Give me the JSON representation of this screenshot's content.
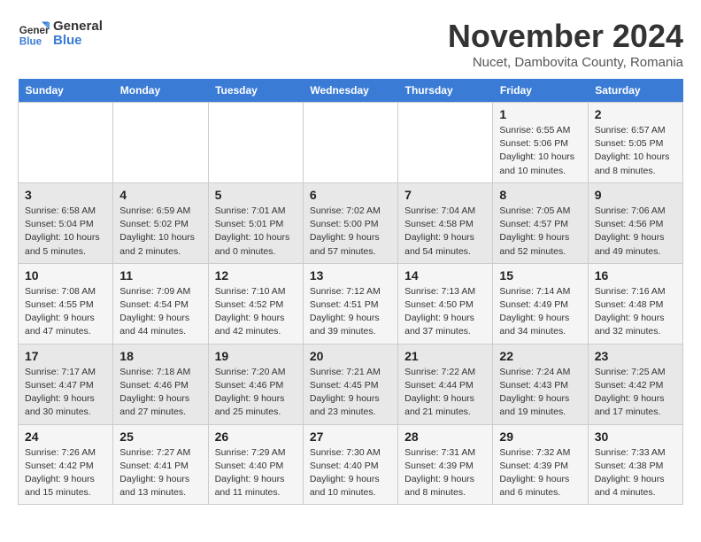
{
  "logo": {
    "line1": "General",
    "line2": "Blue"
  },
  "title": "November 2024",
  "location": "Nucet, Dambovita County, Romania",
  "days_of_week": [
    "Sunday",
    "Monday",
    "Tuesday",
    "Wednesday",
    "Thursday",
    "Friday",
    "Saturday"
  ],
  "weeks": [
    [
      {
        "day": "",
        "info": ""
      },
      {
        "day": "",
        "info": ""
      },
      {
        "day": "",
        "info": ""
      },
      {
        "day": "",
        "info": ""
      },
      {
        "day": "",
        "info": ""
      },
      {
        "day": "1",
        "info": "Sunrise: 6:55 AM\nSunset: 5:06 PM\nDaylight: 10 hours and 10 minutes."
      },
      {
        "day": "2",
        "info": "Sunrise: 6:57 AM\nSunset: 5:05 PM\nDaylight: 10 hours and 8 minutes."
      }
    ],
    [
      {
        "day": "3",
        "info": "Sunrise: 6:58 AM\nSunset: 5:04 PM\nDaylight: 10 hours and 5 minutes."
      },
      {
        "day": "4",
        "info": "Sunrise: 6:59 AM\nSunset: 5:02 PM\nDaylight: 10 hours and 2 minutes."
      },
      {
        "day": "5",
        "info": "Sunrise: 7:01 AM\nSunset: 5:01 PM\nDaylight: 10 hours and 0 minutes."
      },
      {
        "day": "6",
        "info": "Sunrise: 7:02 AM\nSunset: 5:00 PM\nDaylight: 9 hours and 57 minutes."
      },
      {
        "day": "7",
        "info": "Sunrise: 7:04 AM\nSunset: 4:58 PM\nDaylight: 9 hours and 54 minutes."
      },
      {
        "day": "8",
        "info": "Sunrise: 7:05 AM\nSunset: 4:57 PM\nDaylight: 9 hours and 52 minutes."
      },
      {
        "day": "9",
        "info": "Sunrise: 7:06 AM\nSunset: 4:56 PM\nDaylight: 9 hours and 49 minutes."
      }
    ],
    [
      {
        "day": "10",
        "info": "Sunrise: 7:08 AM\nSunset: 4:55 PM\nDaylight: 9 hours and 47 minutes."
      },
      {
        "day": "11",
        "info": "Sunrise: 7:09 AM\nSunset: 4:54 PM\nDaylight: 9 hours and 44 minutes."
      },
      {
        "day": "12",
        "info": "Sunrise: 7:10 AM\nSunset: 4:52 PM\nDaylight: 9 hours and 42 minutes."
      },
      {
        "day": "13",
        "info": "Sunrise: 7:12 AM\nSunset: 4:51 PM\nDaylight: 9 hours and 39 minutes."
      },
      {
        "day": "14",
        "info": "Sunrise: 7:13 AM\nSunset: 4:50 PM\nDaylight: 9 hours and 37 minutes."
      },
      {
        "day": "15",
        "info": "Sunrise: 7:14 AM\nSunset: 4:49 PM\nDaylight: 9 hours and 34 minutes."
      },
      {
        "day": "16",
        "info": "Sunrise: 7:16 AM\nSunset: 4:48 PM\nDaylight: 9 hours and 32 minutes."
      }
    ],
    [
      {
        "day": "17",
        "info": "Sunrise: 7:17 AM\nSunset: 4:47 PM\nDaylight: 9 hours and 30 minutes."
      },
      {
        "day": "18",
        "info": "Sunrise: 7:18 AM\nSunset: 4:46 PM\nDaylight: 9 hours and 27 minutes."
      },
      {
        "day": "19",
        "info": "Sunrise: 7:20 AM\nSunset: 4:46 PM\nDaylight: 9 hours and 25 minutes."
      },
      {
        "day": "20",
        "info": "Sunrise: 7:21 AM\nSunset: 4:45 PM\nDaylight: 9 hours and 23 minutes."
      },
      {
        "day": "21",
        "info": "Sunrise: 7:22 AM\nSunset: 4:44 PM\nDaylight: 9 hours and 21 minutes."
      },
      {
        "day": "22",
        "info": "Sunrise: 7:24 AM\nSunset: 4:43 PM\nDaylight: 9 hours and 19 minutes."
      },
      {
        "day": "23",
        "info": "Sunrise: 7:25 AM\nSunset: 4:42 PM\nDaylight: 9 hours and 17 minutes."
      }
    ],
    [
      {
        "day": "24",
        "info": "Sunrise: 7:26 AM\nSunset: 4:42 PM\nDaylight: 9 hours and 15 minutes."
      },
      {
        "day": "25",
        "info": "Sunrise: 7:27 AM\nSunset: 4:41 PM\nDaylight: 9 hours and 13 minutes."
      },
      {
        "day": "26",
        "info": "Sunrise: 7:29 AM\nSunset: 4:40 PM\nDaylight: 9 hours and 11 minutes."
      },
      {
        "day": "27",
        "info": "Sunrise: 7:30 AM\nSunset: 4:40 PM\nDaylight: 9 hours and 10 minutes."
      },
      {
        "day": "28",
        "info": "Sunrise: 7:31 AM\nSunset: 4:39 PM\nDaylight: 9 hours and 8 minutes."
      },
      {
        "day": "29",
        "info": "Sunrise: 7:32 AM\nSunset: 4:39 PM\nDaylight: 9 hours and 6 minutes."
      },
      {
        "day": "30",
        "info": "Sunrise: 7:33 AM\nSunset: 4:38 PM\nDaylight: 9 hours and 4 minutes."
      }
    ]
  ]
}
